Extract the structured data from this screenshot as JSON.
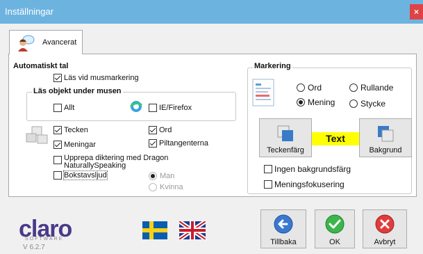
{
  "window": {
    "title": "Inställningar",
    "close": "×"
  },
  "tab": {
    "label": "Avancerat"
  },
  "auto": {
    "title": "Automatiskt tal",
    "las_vid": {
      "label": "Läs vid musmarkering",
      "checked": true
    },
    "objekt": {
      "title": "Läs objekt under musen",
      "allt": {
        "label": "Allt",
        "checked": false
      },
      "iefirefox": {
        "label": "IE/Firefox",
        "checked": false
      }
    },
    "tecken": {
      "label": "Tecken",
      "checked": true
    },
    "ord": {
      "label": "Ord",
      "checked": true
    },
    "meningar": {
      "label": "Meningar",
      "checked": true
    },
    "piltangenterna": {
      "label": "Piltangenterna",
      "checked": true
    },
    "upprepa": {
      "line1": "Upprepa diktering med Dragon",
      "line2": "NaturallySpeaking",
      "checked": false
    },
    "bokstavsljud": {
      "label": "Bokstavsljud",
      "checked": false
    },
    "man": {
      "label": "Man",
      "selected": true
    },
    "kvinna": {
      "label": "Kvinna",
      "selected": false
    }
  },
  "mark": {
    "title": "Markering",
    "ord": {
      "label": "Ord",
      "selected": false
    },
    "rullande": {
      "label": "Rullande",
      "selected": false
    },
    "mening": {
      "label": "Mening",
      "selected": true
    },
    "stycke": {
      "label": "Stycke",
      "selected": false
    },
    "teckenfarg": "Teckenfärg",
    "sample": "Text",
    "bakgrund": "Bakgrund",
    "ingen": {
      "label": "Ingen bakgrundsfärg",
      "checked": false
    },
    "menings": {
      "label": "Meningsfokusering",
      "checked": false
    }
  },
  "footer": {
    "logo": "claro",
    "logo_sub": "SOFTWARE",
    "version": "V 6.2.7",
    "tillbaka": "Tillbaka",
    "ok": "OK",
    "avbryt": "Avbryt"
  },
  "colors": {
    "titlebar": "#6db3e0",
    "close": "#e04343",
    "highlight": "#ffff00"
  }
}
